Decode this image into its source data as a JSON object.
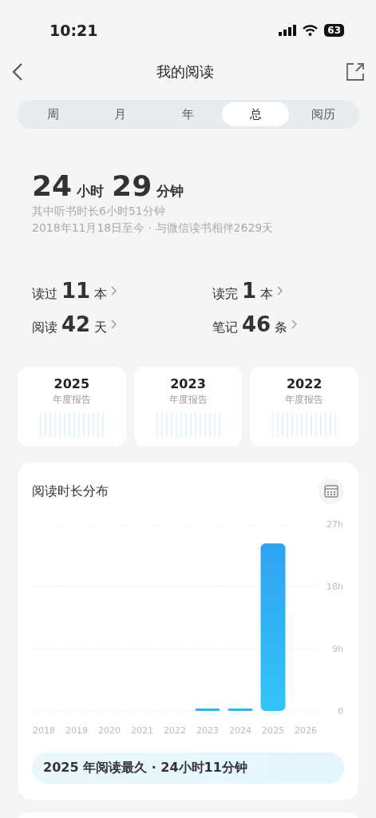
{
  "status_bar": {
    "time": "10:21",
    "battery": "63"
  },
  "header": {
    "title": "我的阅读"
  },
  "tabs": [
    {
      "label": "周",
      "selected": false
    },
    {
      "label": "月",
      "selected": false
    },
    {
      "label": "年",
      "selected": false
    },
    {
      "label": "总",
      "selected": true
    },
    {
      "label": "阅历",
      "selected": false
    }
  ],
  "summary": {
    "hours": "24",
    "hours_unit": "小时",
    "minutes": "29",
    "minutes_unit": "分钟",
    "listen_note": "其中听书时长6小时51分钟",
    "since_note": "2018年11月18日至今 · 与微信读书相伴2629天"
  },
  "stats": [
    {
      "label": "读过",
      "value": "11",
      "unit": "本"
    },
    {
      "label": "读完",
      "value": "1",
      "unit": "本"
    },
    {
      "label": "阅读",
      "value": "42",
      "unit": "天"
    },
    {
      "label": "笔记",
      "value": "46",
      "unit": "条"
    }
  ],
  "year_reports": [
    {
      "year": "2025",
      "caption": "年度报告"
    },
    {
      "year": "2023",
      "caption": "年度报告"
    },
    {
      "year": "2022",
      "caption": "年度报告"
    }
  ],
  "distribution": {
    "title": "阅读时长分布",
    "highlight": "2025 年阅读最久 · 24小时11分钟",
    "chart_data": {
      "type": "bar",
      "categories": [
        "2018",
        "2019",
        "2020",
        "2021",
        "2022",
        "2023",
        "2024",
        "2025",
        "2026"
      ],
      "values": [
        null,
        null,
        null,
        null,
        null,
        0.2,
        0.2,
        24.2,
        null
      ],
      "ylim": [
        0,
        27
      ],
      "yticks": [
        {
          "value": 0,
          "label": "0"
        },
        {
          "value": 9,
          "label": "9h"
        },
        {
          "value": 18,
          "label": "18h"
        },
        {
          "value": 27,
          "label": "27h"
        }
      ]
    }
  }
}
